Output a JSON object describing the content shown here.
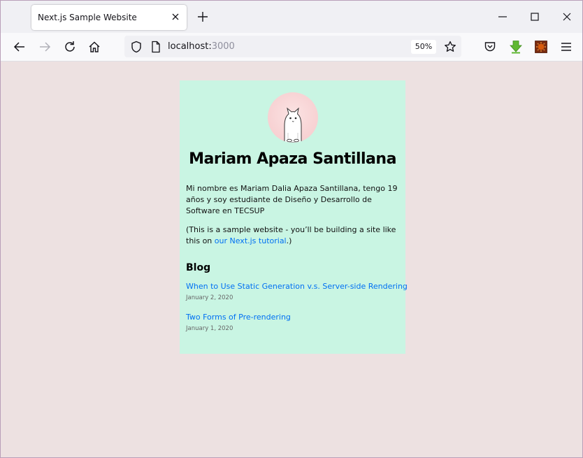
{
  "browser": {
    "tab_title": "Next.js Sample Website",
    "url_host": "localhost:",
    "url_port": "3000",
    "zoom": "50%"
  },
  "page": {
    "name": "Mariam Apaza Santillana",
    "intro": "Mi nombre es Mariam Dalia Apaza Santillana, tengo 19 años y soy estudiante de Diseño y Desarrollo de Software en TECSUP",
    "note_before": "(This is a sample website - you’ll be building a site like this on ",
    "note_link": "our Next.js tutorial",
    "note_after": ".)",
    "blog_heading": "Blog",
    "posts": [
      {
        "title": "When to Use Static Generation v.s. Server-side Rendering",
        "date": "January 2, 2020"
      },
      {
        "title": "Two Forms of Pre-rendering",
        "date": "January 1, 2020"
      }
    ]
  },
  "colors": {
    "page_background": "#ede1e1",
    "card_background": "#c9f5e3",
    "link": "#0070f3",
    "extension_green": "#5fb831",
    "extension_orange": "#d85b0c"
  },
  "icons": [
    "close-icon",
    "plus-icon",
    "minimize-icon",
    "maximize-icon",
    "back-arrow-icon",
    "forward-arrow-icon",
    "reload-icon",
    "home-icon",
    "shield-icon",
    "page-icon",
    "star-icon",
    "pocket-icon",
    "download-extension-icon",
    "extension-icon",
    "menu-icon"
  ]
}
